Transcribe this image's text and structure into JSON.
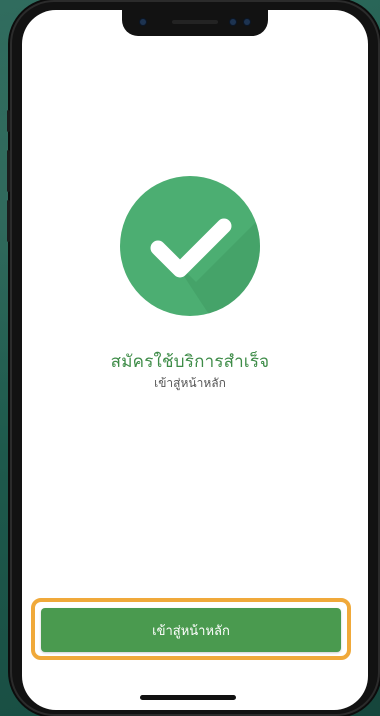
{
  "success": {
    "title": "สมัครใช้บริการสำเร็จ",
    "subtitle": "เข้าสู่หน้าหลัก",
    "icon": "check-circle-icon",
    "icon_color": "#4cae72"
  },
  "actions": {
    "home_button_label": "เข้าสู่หน้าหลัก",
    "button_color": "#4a9a4f",
    "highlight_color": "#f0a93a"
  }
}
